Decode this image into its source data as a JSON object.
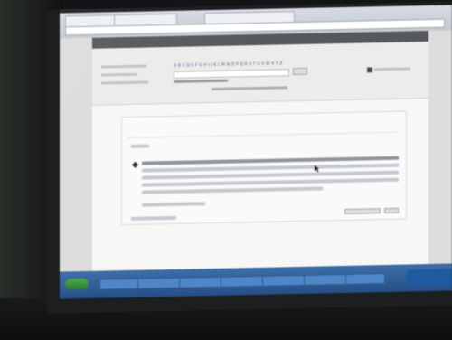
{
  "browser": {
    "tabs": [
      "",
      "",
      ""
    ],
    "address": ""
  },
  "nav": {
    "items": [
      "",
      "",
      "",
      "",
      "",
      "",
      "",
      ""
    ]
  },
  "search_panel": {
    "title": "",
    "alphabet": [
      "A",
      "B",
      "C",
      "D",
      "E",
      "F",
      "G",
      "H",
      "I",
      "J",
      "K",
      "L",
      "M",
      "N",
      "O",
      "P",
      "Q",
      "R",
      "S",
      "T",
      "U",
      "V",
      "W",
      "X",
      "Y",
      "Z"
    ]
  },
  "result": {
    "title": "",
    "subtitle": ""
  },
  "taskbar": {
    "start_label": "",
    "items": [
      "",
      "",
      "",
      "",
      "",
      "",
      ""
    ]
  },
  "colors": {
    "navbar": "#56585c",
    "taskbar": "#2d5f9a",
    "page_bg": "#f7f7f6"
  }
}
